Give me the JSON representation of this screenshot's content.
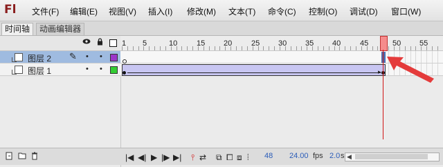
{
  "app": {
    "logo": "Fl"
  },
  "menu": {
    "items": [
      "文件(F)",
      "编辑(E)",
      "视图(V)",
      "插入(I)",
      "修改(M)",
      "文本(T)",
      "命令(C)",
      "控制(O)",
      "调试(D)",
      "窗口(W)"
    ]
  },
  "tabs": [
    "时间轴",
    "动画编辑器"
  ],
  "ruler": {
    "labels": [
      "1",
      "5",
      "10",
      "15",
      "20",
      "25",
      "30",
      "35",
      "40",
      "45",
      "50",
      "55"
    ]
  },
  "layers": [
    {
      "name": "图层 2",
      "selected": true,
      "color": "#9b35c9"
    },
    {
      "name": "图层 1",
      "selected": false,
      "color": "#33cc33"
    }
  ],
  "playhead": {
    "frame": 48
  },
  "status": {
    "current_frame": "48",
    "fps": "24.00",
    "fps_unit": "fps",
    "time": "2.0",
    "time_unit": "s"
  },
  "colors": {
    "playhead": "#d01414",
    "arrow": "#e43b3b",
    "tween": "#c8c6f2",
    "selected_row": "#9fbbe0"
  }
}
